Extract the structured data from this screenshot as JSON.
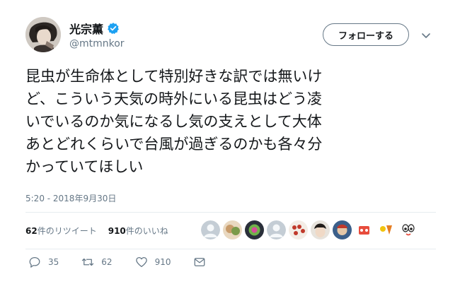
{
  "user": {
    "display_name": "光宗薫",
    "handle": "@mtmnkor",
    "verified": true,
    "avatar_icon": "user-avatar"
  },
  "follow_button": {
    "label": "フォローする"
  },
  "caret_icon": "chevron-down-icon",
  "tweet": {
    "lines": [
      "昆虫が生命体として特別好きな訳では無いけ",
      "ど、こういう天気の時外にいる昆虫はどう凌",
      "いでいるのか気になるし気の支えとして大体",
      "あとどれくらいで台風が過ぎるのかも各々分",
      "かっていてほしい"
    ],
    "timestamp": "5:20 - 2018年9月30日"
  },
  "stats": {
    "retweet_count": "62",
    "retweet_label": "件のリツイート",
    "like_count": "910",
    "like_label": "件のいいね"
  },
  "likers": {
    "icons": [
      "liker-avatar-1",
      "liker-avatar-2",
      "liker-avatar-3",
      "liker-avatar-4",
      "liker-avatar-5",
      "liker-avatar-6",
      "liker-avatar-7",
      "liker-avatar-8",
      "liker-avatar-9",
      "liker-avatar-10"
    ]
  },
  "actions": {
    "reply_count": "35",
    "retweet_count": "62",
    "like_count": "910"
  },
  "colors": {
    "text_primary": "#14171a",
    "text_secondary": "#657786",
    "verified_blue": "#1da1f2",
    "divider": "#e6ecf0"
  }
}
